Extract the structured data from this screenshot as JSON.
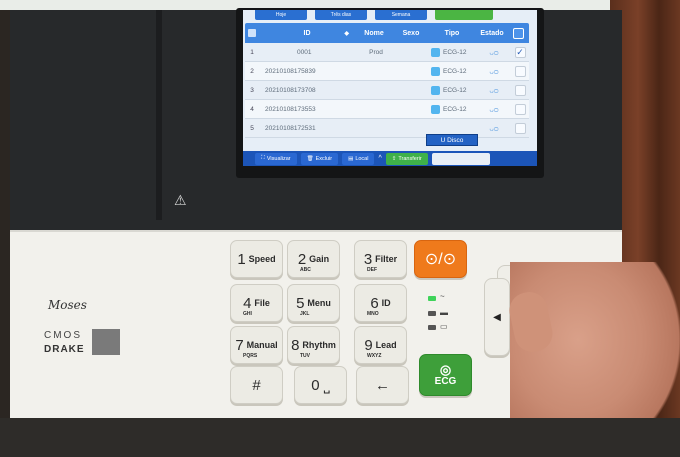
{
  "screen": {
    "top_tabs": [
      "Hoje",
      "Três dias",
      "Semana",
      ""
    ],
    "columns": {
      "id": "ID",
      "nome": "Nome",
      "sexo": "Sexo",
      "tipo": "Tipo",
      "estado": "Estado"
    },
    "rows": [
      {
        "num": "1",
        "id": "0001",
        "nome": "Prod",
        "sexo": "",
        "tipo": "ECG-12",
        "estado": "ᴗᴑ",
        "checked": "✓"
      },
      {
        "num": "2",
        "id": "20210108175839",
        "nome": "",
        "sexo": "",
        "tipo": "ECG-12",
        "estado": "ᴗᴑ",
        "checked": ""
      },
      {
        "num": "3",
        "id": "20210108173708",
        "nome": "",
        "sexo": "",
        "tipo": "ECG-12",
        "estado": "ᴗᴑ",
        "checked": ""
      },
      {
        "num": "4",
        "id": "20210108173553",
        "nome": "",
        "sexo": "",
        "tipo": "ECG-12",
        "estado": "ᴗᴑ",
        "checked": ""
      },
      {
        "num": "5",
        "id": "20210108172531",
        "nome": "",
        "sexo": "",
        "tipo": "",
        "estado": "ᴗᴑ",
        "checked": ""
      }
    ],
    "popup_label": "U Disco",
    "bottom_bar": {
      "visualizar": "Visualizar",
      "excluir": "Excluir",
      "local": "Local",
      "transferir": "Transferir"
    }
  },
  "brand": {
    "moses": "Moses",
    "cmos": "CMOS",
    "drake": "DRAKE"
  },
  "keypad": {
    "k1": {
      "num": "1",
      "label": "Speed",
      "sub": ""
    },
    "k2": {
      "num": "2",
      "label": "Gain",
      "sub": "ABC"
    },
    "k3": {
      "num": "3",
      "label": "Filter",
      "sub": "DEF"
    },
    "k4": {
      "num": "4",
      "label": "File",
      "sub": "GHI"
    },
    "k5": {
      "num": "5",
      "label": "Menu",
      "sub": "JKL"
    },
    "k6": {
      "num": "6",
      "label": "ID",
      "sub": "MNO"
    },
    "k7": {
      "num": "7",
      "label": "Manual",
      "sub": "PQRS"
    },
    "k8": {
      "num": "8",
      "label": "Rhythm",
      "sub": "TUV"
    },
    "k9": {
      "num": "9",
      "label": "Lead",
      "sub": "WXYZ"
    },
    "hash": "#",
    "zero": "0 ⎵",
    "back": "←",
    "power": "⊙/⊙",
    "ecg": "ECG"
  },
  "colors": {
    "accent_blue": "#3f86e0",
    "power_orange": "#ef7a1c",
    "ecg_green": "#3e9f3a"
  }
}
